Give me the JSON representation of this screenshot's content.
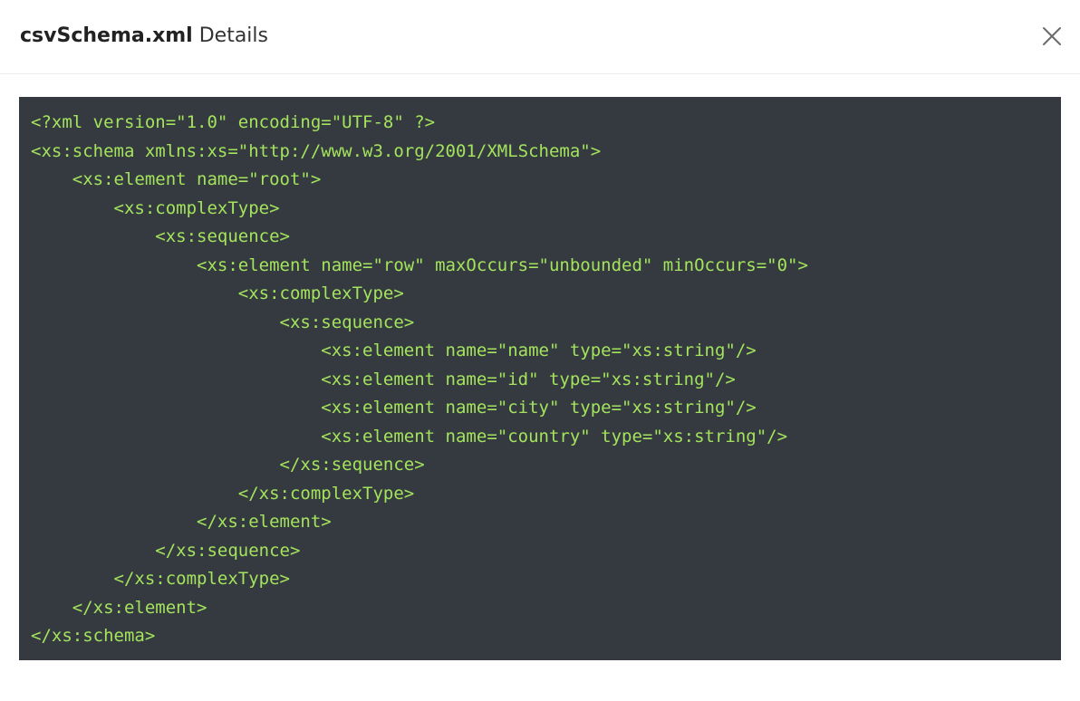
{
  "dialog": {
    "title_filename": "csvSchema.xml",
    "title_suffix": " Details",
    "close_icon": "close-icon"
  },
  "colors": {
    "code_background": "#343a40",
    "code_text": "#a4e35c"
  },
  "code": {
    "lines": [
      "<?xml version=\"1.0\" encoding=\"UTF-8\" ?>",
      "<xs:schema xmlns:xs=\"http://www.w3.org/2001/XMLSchema\">",
      "    <xs:element name=\"root\">",
      "        <xs:complexType>",
      "            <xs:sequence>",
      "                <xs:element name=\"row\" maxOccurs=\"unbounded\" minOccurs=\"0\">",
      "                    <xs:complexType>",
      "                        <xs:sequence>",
      "                            <xs:element name=\"name\" type=\"xs:string\"/>",
      "                            <xs:element name=\"id\" type=\"xs:string\"/>",
      "                            <xs:element name=\"city\" type=\"xs:string\"/>",
      "                            <xs:element name=\"country\" type=\"xs:string\"/>",
      "                        </xs:sequence>",
      "                    </xs:complexType>",
      "                </xs:element>",
      "            </xs:sequence>",
      "        </xs:complexType>",
      "    </xs:element>",
      "</xs:schema>"
    ]
  }
}
